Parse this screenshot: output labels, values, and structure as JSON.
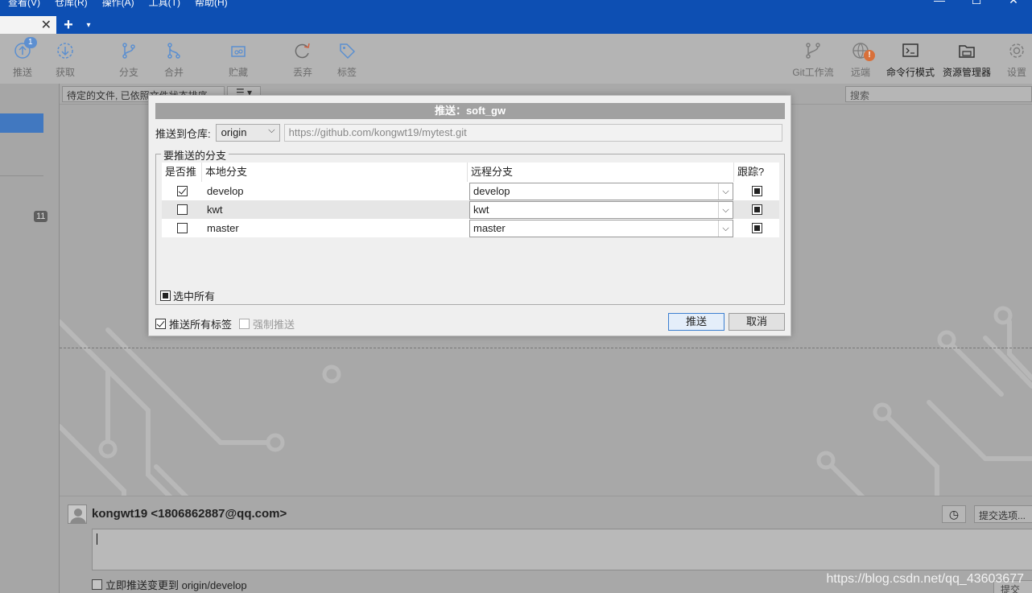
{
  "menu": [
    "查看(V)",
    "仓库(R)",
    "操作(A)",
    "工具(T)",
    "帮助(H)"
  ],
  "window_controls": [
    "—",
    "☐",
    "✕"
  ],
  "tabs": {
    "close_glyph": "✕",
    "add_glyph": "+",
    "menu_glyph": "▾"
  },
  "toolbar": {
    "push": {
      "label": "推送",
      "badge": "1"
    },
    "fetch": {
      "label": "获取"
    },
    "branch": {
      "label": "分支"
    },
    "merge": {
      "label": "合并"
    },
    "stash": {
      "label": "贮藏"
    },
    "discard": {
      "label": "丢弃"
    },
    "tag": {
      "label": "标签"
    },
    "gitflow": {
      "label": "Git工作流"
    },
    "remote": {
      "label": "远端",
      "alert": "!"
    },
    "terminal": {
      "label": "命令行模式"
    },
    "explorer": {
      "label": "资源管理器"
    },
    "settings": {
      "label": "设置"
    }
  },
  "left_panel": {
    "count": "11"
  },
  "filter": {
    "sort_label": "待定的文件, 已依照文件状态排序",
    "menu_label": "☰ ▾",
    "search_placeholder": "搜索"
  },
  "commit": {
    "author": "kongwt19 <1806862887@qq.com>",
    "history_icon": "◷",
    "options_label": "提交选项...",
    "push_now_label": "立即推送变更到 origin/develop",
    "submit_label": "提交"
  },
  "watermark": "https://blog.csdn.net/qq_43603677",
  "dialog": {
    "title": "推送：soft_gw",
    "push_to_label": "推送到仓库:",
    "repo": "origin",
    "repo_url": "https://github.com/kongwt19/mytest.git",
    "branches_legend": "要推送的分支",
    "headers": {
      "push": "是否推",
      "local": "本地分支",
      "remote": "远程分支",
      "track": "跟踪?"
    },
    "branches": [
      {
        "push": true,
        "local": "develop",
        "remote": "develop",
        "track": true
      },
      {
        "push": false,
        "local": "kwt",
        "remote": "kwt",
        "track": true
      },
      {
        "push": false,
        "local": "master",
        "remote": "master",
        "track": true
      }
    ],
    "select_all_label": "选中所有",
    "push_all_tags_label": "推送所有标签",
    "push_all_tags": true,
    "force_push_label": "强制推送",
    "force_push": false,
    "ok_label": "推送",
    "cancel_label": "取消"
  }
}
